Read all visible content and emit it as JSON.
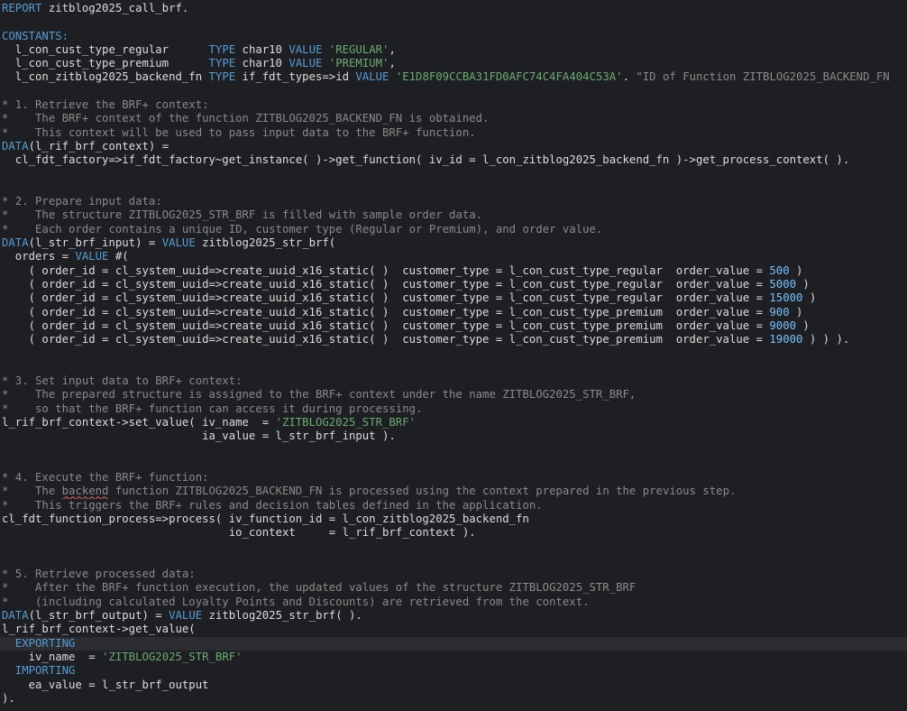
{
  "editor": {
    "language": "ABAP",
    "current_line": 46,
    "colors": {
      "background": "#1e1f22",
      "current_line": "#2b2d30",
      "keyword": "#569cd6",
      "string": "#6aab73",
      "number": "#79c0ff",
      "comment": "#8a8a8a",
      "identifier": "#dcdcdc"
    },
    "lines": [
      [
        [
          "kw",
          "REPORT"
        ],
        [
          "id",
          " zitblog2025_call_brf."
        ]
      ],
      [],
      [
        [
          "kw",
          "CONSTANTS:"
        ]
      ],
      [
        [
          "id",
          "  l_con_cust_type_regular      "
        ],
        [
          "kw",
          "TYPE"
        ],
        [
          "id",
          " char10 "
        ],
        [
          "kw",
          "VALUE"
        ],
        [
          "str",
          " 'REGULAR'"
        ],
        [
          "id",
          ","
        ]
      ],
      [
        [
          "id",
          "  l_con_cust_type_premium      "
        ],
        [
          "kw",
          "TYPE"
        ],
        [
          "id",
          " char10 "
        ],
        [
          "kw",
          "VALUE"
        ],
        [
          "str",
          " 'PREMIUM'"
        ],
        [
          "id",
          ","
        ]
      ],
      [
        [
          "id",
          "  l_con_zitblog2025_backend_fn "
        ],
        [
          "kw",
          "TYPE"
        ],
        [
          "id",
          " if_fdt_types=>id "
        ],
        [
          "kw",
          "VALUE"
        ],
        [
          "str",
          " 'E1D8F09CCBA31FD0AFC74C4FA404C53A'"
        ],
        [
          "id",
          ". "
        ],
        [
          "com",
          "\"ID of Function ZITBLOG2025_BACKEND_FN"
        ]
      ],
      [],
      [
        [
          "com",
          "* 1. Retrieve the BRF+ context:"
        ]
      ],
      [
        [
          "com",
          "*    The BRF+ context of the function ZITBLOG2025_BACKEND_FN is obtained."
        ]
      ],
      [
        [
          "com",
          "*    This context will be used to pass input data to the BRF+ function."
        ]
      ],
      [
        [
          "kw",
          "DATA"
        ],
        [
          "id",
          "(l_rif_brf_context) ="
        ]
      ],
      [
        [
          "id",
          "  cl_fdt_factory=>if_fdt_factory~get_instance( )->get_function( iv_id = l_con_zitblog2025_backend_fn )->get_process_context( )."
        ]
      ],
      [],
      [],
      [
        [
          "com",
          "* 2. Prepare input data:"
        ]
      ],
      [
        [
          "com",
          "*    The structure ZITBLOG2025_STR_BRF is filled with sample order data."
        ]
      ],
      [
        [
          "com",
          "*    Each order contains a unique ID, customer type (Regular or Premium), and order value."
        ]
      ],
      [
        [
          "kw",
          "DATA"
        ],
        [
          "id",
          "(l_str_brf_input) = "
        ],
        [
          "kw",
          "VALUE"
        ],
        [
          "id",
          " zitblog2025_str_brf("
        ]
      ],
      [
        [
          "id",
          "  orders = "
        ],
        [
          "kw",
          "VALUE"
        ],
        [
          "id",
          " #("
        ]
      ],
      [
        [
          "id",
          "    ( order_id = cl_system_uuid=>create_uuid_x16_static( )  customer_type = l_con_cust_type_regular  order_value = "
        ],
        [
          "num",
          "500"
        ],
        [
          "id",
          " )"
        ]
      ],
      [
        [
          "id",
          "    ( order_id = cl_system_uuid=>create_uuid_x16_static( )  customer_type = l_con_cust_type_regular  order_value = "
        ],
        [
          "num",
          "5000"
        ],
        [
          "id",
          " )"
        ]
      ],
      [
        [
          "id",
          "    ( order_id = cl_system_uuid=>create_uuid_x16_static( )  customer_type = l_con_cust_type_regular  order_value = "
        ],
        [
          "num",
          "15000"
        ],
        [
          "id",
          " )"
        ]
      ],
      [
        [
          "id",
          "    ( order_id = cl_system_uuid=>create_uuid_x16_static( )  customer_type = l_con_cust_type_premium  order_value = "
        ],
        [
          "num",
          "900"
        ],
        [
          "id",
          " )"
        ]
      ],
      [
        [
          "id",
          "    ( order_id = cl_system_uuid=>create_uuid_x16_static( )  customer_type = l_con_cust_type_premium  order_value = "
        ],
        [
          "num",
          "9000"
        ],
        [
          "id",
          " )"
        ]
      ],
      [
        [
          "id",
          "    ( order_id = cl_system_uuid=>create_uuid_x16_static( )  customer_type = l_con_cust_type_premium  order_value = "
        ],
        [
          "num",
          "19000"
        ],
        [
          "id",
          " ) ) )."
        ]
      ],
      [],
      [],
      [
        [
          "com",
          "* 3. Set input data to BRF+ context:"
        ]
      ],
      [
        [
          "com",
          "*    The prepared structure is assigned to the BRF+ context under the name ZITBLOG2025_STR_BRF,"
        ]
      ],
      [
        [
          "com",
          "*    so that the BRF+ function can access it during processing."
        ]
      ],
      [
        [
          "id",
          "l_rif_brf_context->set_value( iv_name  = "
        ],
        [
          "str",
          "'ZITBLOG2025_STR_BRF'"
        ]
      ],
      [
        [
          "id",
          "                              ia_value = l_str_brf_input )."
        ]
      ],
      [],
      [],
      [
        [
          "com",
          "* 4. Execute the BRF+ function:"
        ]
      ],
      [
        [
          "com",
          "*    The "
        ],
        [
          "warn",
          "backend"
        ],
        [
          "com",
          " function ZITBLOG2025_BACKEND_FN is processed using the context prepared in the previous step."
        ]
      ],
      [
        [
          "com",
          "*    This triggers the BRF+ rules and decision tables defined in the application."
        ]
      ],
      [
        [
          "id",
          "cl_fdt_function_process=>process( iv_function_id = l_con_zitblog2025_backend_fn"
        ]
      ],
      [
        [
          "id",
          "                                  io_context     = l_rif_brf_context )."
        ]
      ],
      [],
      [],
      [
        [
          "com",
          "* 5. Retrieve processed data:"
        ]
      ],
      [
        [
          "com",
          "*    After the BRF+ function execution, the updated values of the structure ZITBLOG2025_STR_BRF"
        ]
      ],
      [
        [
          "com",
          "*    (including calculated Loyalty Points and Discounts) are retrieved from the context."
        ]
      ],
      [
        [
          "kw",
          "DATA"
        ],
        [
          "id",
          "(l_str_brf_output) = "
        ],
        [
          "kw",
          "VALUE"
        ],
        [
          "id",
          " zitblog2025_str_brf( )."
        ]
      ],
      [
        [
          "id",
          "l_rif_brf_context->get_value("
        ]
      ],
      [
        [
          "kw",
          "  EXPORTING"
        ]
      ],
      [
        [
          "id",
          "    iv_name  = "
        ],
        [
          "str",
          "'ZITBLOG2025_STR_BRF'"
        ]
      ],
      [
        [
          "kw",
          "  IMPORTING"
        ]
      ],
      [
        [
          "id",
          "    ea_value = l_str_brf_output"
        ]
      ],
      [
        [
          "id",
          ")."
        ]
      ]
    ]
  }
}
